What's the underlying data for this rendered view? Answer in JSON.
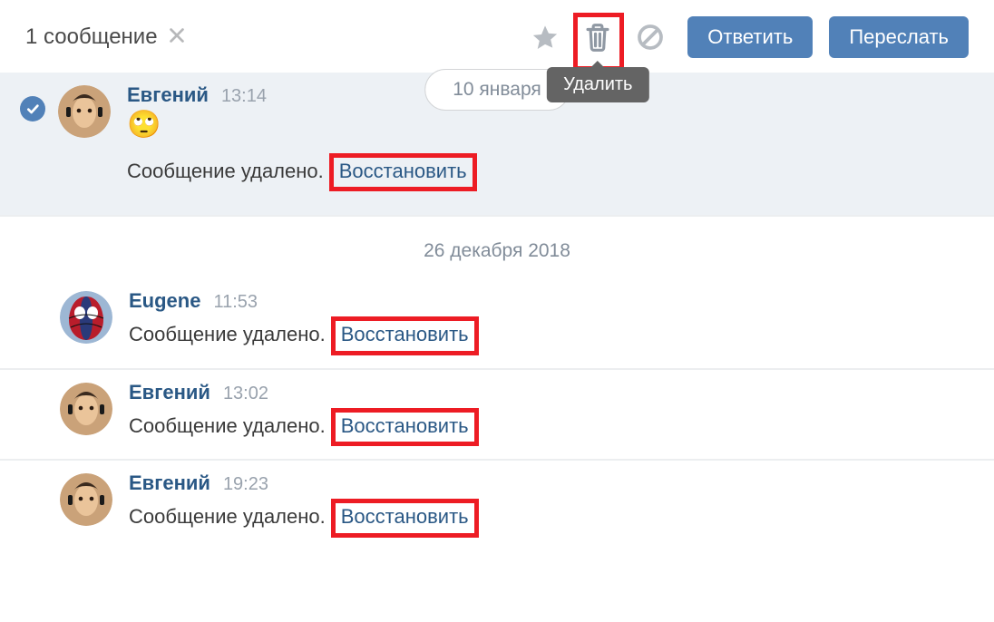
{
  "header": {
    "selection_count_text": "1 сообщение",
    "tooltip_delete": "Удалить",
    "reply_label": "Ответить",
    "forward_label": "Переслать"
  },
  "dates": {
    "jan10": "10 января",
    "dec26": "26 декабря 2018"
  },
  "strings": {
    "deleted": "Сообщение удалено.",
    "restore": "Восстановить"
  },
  "messages": [
    {
      "name": "Евгений",
      "time": "13:14",
      "avatar": "face1",
      "selected": true,
      "has_emoji": true
    },
    {
      "name": "Eugene",
      "time": "11:53",
      "avatar": "spider",
      "selected": false,
      "has_emoji": false
    },
    {
      "name": "Евгений",
      "time": "13:02",
      "avatar": "face1",
      "selected": false,
      "has_emoji": false
    },
    {
      "name": "Евгений",
      "time": "19:23",
      "avatar": "face1",
      "selected": false,
      "has_emoji": false
    }
  ]
}
